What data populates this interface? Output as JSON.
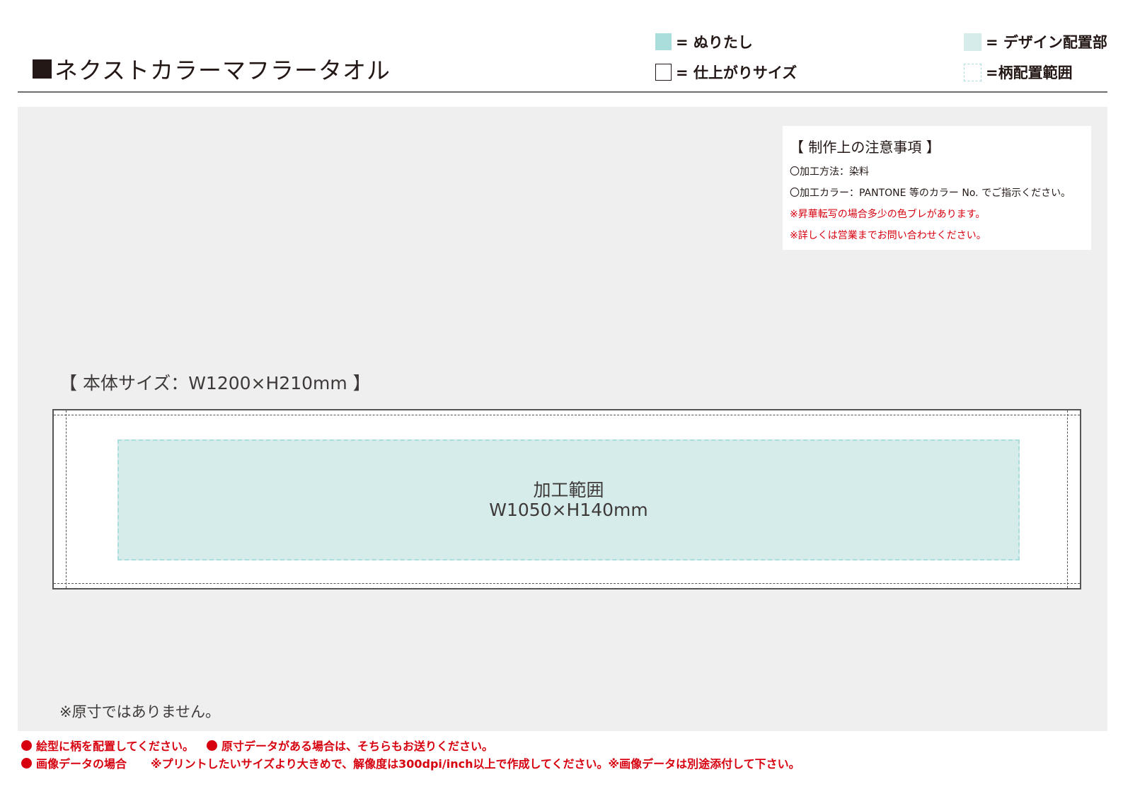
{
  "header": {
    "title": "ネクストカラーマフラータオル"
  },
  "legend": {
    "bleed": "= ぬりたし",
    "finish_size": "= 仕上がりサイズ",
    "design_part": "= デザイン配置部",
    "pattern_area": "=柄配置範囲"
  },
  "notes": {
    "heading": "【 制作上の注意事項 】",
    "lines": [
      "〇加工方法：染料",
      "〇加工カラー：PANTONE 等のカラー No. でご指示ください。",
      "※昇華転写の場合多少の色ブレがあります。",
      "※詳しくは営業までお問い合わせください。"
    ]
  },
  "body_size": "【 本体サイズ：W1200×H210mm 】",
  "design_area": {
    "label": "加工範囲",
    "size": "W1050×H140mm"
  },
  "not_actual_size": "※原寸ではありません。",
  "footer": {
    "line1_a": "絵型に柄を配置してください。",
    "line1_b": "原寸データがある場合は、そちらもお送りください。",
    "line2_a": "画像データの場合",
    "line2_b": "※プリントしたいサイズより大きめで、解像度は300dpi/inch以上で作成してください。※画像データは別途添付して下さい。"
  },
  "colors": {
    "bleed": "#a9dedc",
    "design": "#d6ecea",
    "canvas": "#eeefee",
    "warning": "#d7000f"
  }
}
